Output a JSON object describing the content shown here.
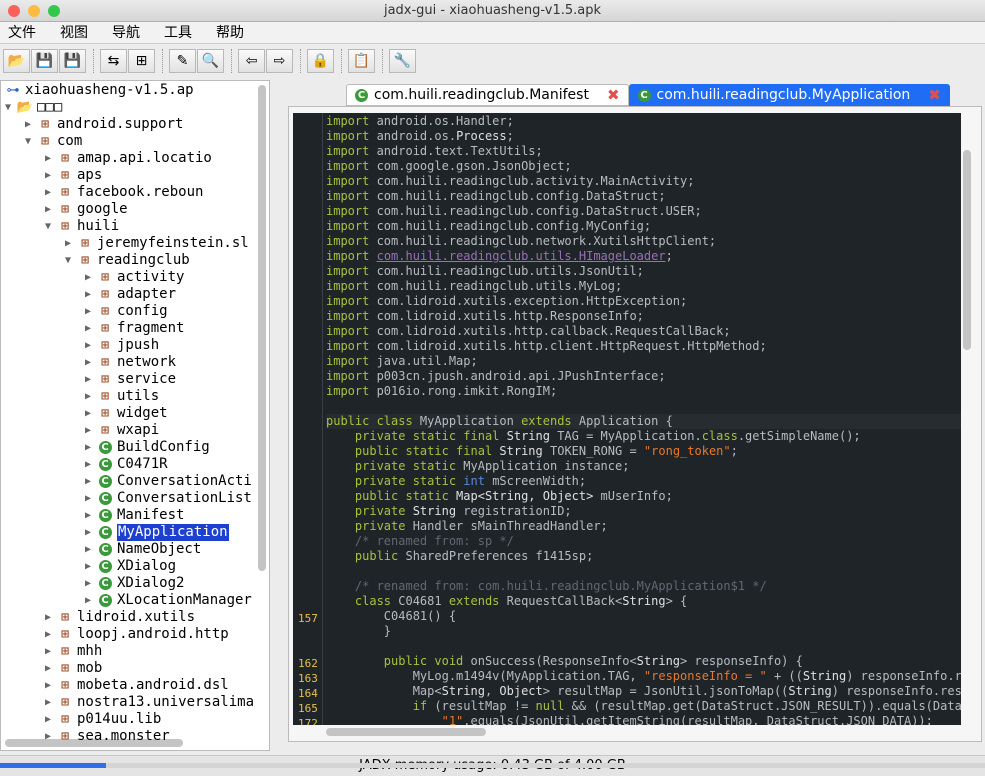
{
  "window": {
    "title": "jadx-gui - xiaohuasheng-v1.5.apk"
  },
  "menu": [
    "文件",
    "视图",
    "导航",
    "工具",
    "帮助"
  ],
  "toolbar": [
    {
      "icon": "open-file-icon",
      "glyph": "📂"
    },
    {
      "icon": "save-all-icon",
      "glyph": "💾"
    },
    {
      "icon": "export-icon",
      "glyph": "💾"
    },
    null,
    {
      "icon": "sync-icon",
      "glyph": "⇆"
    },
    {
      "icon": "flatten-packages-icon",
      "glyph": "⊞"
    },
    null,
    {
      "icon": "text-search-icon",
      "glyph": "✎"
    },
    {
      "icon": "class-search-icon",
      "glyph": "🔍"
    },
    null,
    {
      "icon": "back-icon",
      "glyph": "⇦"
    },
    {
      "icon": "forward-icon",
      "glyph": "⇨"
    },
    null,
    {
      "icon": "deobfuscation-icon",
      "glyph": "🔒"
    },
    null,
    {
      "icon": "log-icon",
      "glyph": "📋"
    },
    null,
    {
      "icon": "preferences-icon",
      "glyph": "🔧"
    }
  ],
  "tree": [
    {
      "label": "xiaohuasheng-v1.5.ap",
      "level": 0,
      "exp": "",
      "icon": "root"
    },
    {
      "label": "□□□",
      "level": 0,
      "exp": "open",
      "icon": "folder"
    },
    {
      "label": "android.support",
      "level": 1,
      "exp": "closed",
      "icon": "pkg"
    },
    {
      "label": "com",
      "level": 1,
      "exp": "open",
      "icon": "pkg"
    },
    {
      "label": "amap.api.locatio",
      "level": 2,
      "exp": "closed",
      "icon": "pkg"
    },
    {
      "label": "aps",
      "level": 2,
      "exp": "closed",
      "icon": "pkg"
    },
    {
      "label": "facebook.reboun",
      "level": 2,
      "exp": "closed",
      "icon": "pkg"
    },
    {
      "label": "google",
      "level": 2,
      "exp": "closed",
      "icon": "pkg"
    },
    {
      "label": "huili",
      "level": 2,
      "exp": "open",
      "icon": "pkg"
    },
    {
      "label": "jeremyfeinstein.sl",
      "level": 3,
      "exp": "closed",
      "icon": "pkg"
    },
    {
      "label": "readingclub",
      "level": 3,
      "exp": "open",
      "icon": "pkg"
    },
    {
      "label": "activity",
      "level": 4,
      "exp": "closed",
      "icon": "pkg"
    },
    {
      "label": "adapter",
      "level": 4,
      "exp": "closed",
      "icon": "pkg"
    },
    {
      "label": "config",
      "level": 4,
      "exp": "closed",
      "icon": "pkg"
    },
    {
      "label": "fragment",
      "level": 4,
      "exp": "closed",
      "icon": "pkg"
    },
    {
      "label": "jpush",
      "level": 4,
      "exp": "closed",
      "icon": "pkg"
    },
    {
      "label": "network",
      "level": 4,
      "exp": "closed",
      "icon": "pkg"
    },
    {
      "label": "service",
      "level": 4,
      "exp": "closed",
      "icon": "pkg"
    },
    {
      "label": "utils",
      "level": 4,
      "exp": "closed",
      "icon": "pkg"
    },
    {
      "label": "widget",
      "level": 4,
      "exp": "closed",
      "icon": "pkg"
    },
    {
      "label": "wxapi",
      "level": 4,
      "exp": "closed",
      "icon": "pkg"
    },
    {
      "label": "BuildConfig",
      "level": 4,
      "exp": "closed",
      "icon": "cls"
    },
    {
      "label": "C0471R",
      "level": 4,
      "exp": "closed",
      "icon": "cls"
    },
    {
      "label": "ConversationActi",
      "level": 4,
      "exp": "closed",
      "icon": "cls"
    },
    {
      "label": "ConversationList",
      "level": 4,
      "exp": "closed",
      "icon": "cls"
    },
    {
      "label": "Manifest",
      "level": 4,
      "exp": "closed",
      "icon": "cls"
    },
    {
      "label": "MyApplication",
      "level": 4,
      "exp": "closed",
      "icon": "cls",
      "selected": true
    },
    {
      "label": "NameObject",
      "level": 4,
      "exp": "closed",
      "icon": "cls"
    },
    {
      "label": "XDialog",
      "level": 4,
      "exp": "closed",
      "icon": "cls"
    },
    {
      "label": "XDialog2",
      "level": 4,
      "exp": "closed",
      "icon": "cls"
    },
    {
      "label": "XLocationManager",
      "level": 4,
      "exp": "closed",
      "icon": "cls"
    },
    {
      "label": "lidroid.xutils",
      "level": 2,
      "exp": "closed",
      "icon": "pkg"
    },
    {
      "label": "loopj.android.http",
      "level": 2,
      "exp": "closed",
      "icon": "pkg"
    },
    {
      "label": "mhh",
      "level": 2,
      "exp": "closed",
      "icon": "pkg"
    },
    {
      "label": "mob",
      "level": 2,
      "exp": "closed",
      "icon": "pkg"
    },
    {
      "label": "mobeta.android.dsl",
      "level": 2,
      "exp": "closed",
      "icon": "pkg"
    },
    {
      "label": "nostra13.universalima",
      "level": 2,
      "exp": "closed",
      "icon": "pkg"
    },
    {
      "label": "p014uu.lib",
      "level": 2,
      "exp": "closed",
      "icon": "pkg"
    },
    {
      "label": "sea.monster",
      "level": 2,
      "exp": "closed",
      "icon": "pkg"
    }
  ],
  "tabs": [
    {
      "label": "com.huili.readingclub.Manifest",
      "active": false
    },
    {
      "label": "com.huili.readingclub.MyApplication",
      "active": true
    }
  ],
  "code": [
    {
      "ln": "",
      "t": [
        [
          "k",
          "import"
        ],
        [
          "t",
          " android.os.Handler;"
        ]
      ]
    },
    {
      "ln": "",
      "t": [
        [
          "k",
          "import"
        ],
        [
          "t",
          " android.os."
        ],
        [
          "w",
          "Process"
        ],
        [
          "t",
          ";"
        ]
      ]
    },
    {
      "ln": "",
      "t": [
        [
          "k",
          "import"
        ],
        [
          "t",
          " android.text.TextUtils;"
        ]
      ]
    },
    {
      "ln": "",
      "t": [
        [
          "k",
          "import"
        ],
        [
          "t",
          " com.google.gson.JsonObject;"
        ]
      ]
    },
    {
      "ln": "",
      "t": [
        [
          "k",
          "import"
        ],
        [
          "t",
          " com.huili.readingclub.activity.MainActivity;"
        ]
      ]
    },
    {
      "ln": "",
      "t": [
        [
          "k",
          "import"
        ],
        [
          "t",
          " com.huili.readingclub.config.DataStruct;"
        ]
      ]
    },
    {
      "ln": "",
      "t": [
        [
          "k",
          "import"
        ],
        [
          "t",
          " com.huili.readingclub.config.DataStruct.USER;"
        ]
      ]
    },
    {
      "ln": "",
      "t": [
        [
          "k",
          "import"
        ],
        [
          "t",
          " com.huili.readingclub.config.MyConfig;"
        ]
      ]
    },
    {
      "ln": "",
      "t": [
        [
          "k",
          "import"
        ],
        [
          "t",
          " com.huili.readingclub.network.XutilsHttpClient;"
        ]
      ]
    },
    {
      "ln": "",
      "t": [
        [
          "k",
          "import"
        ],
        [
          "t",
          " "
        ],
        [
          "l",
          "com.huili.readingclub.utils.HImageLoader"
        ],
        [
          "t",
          ";"
        ]
      ]
    },
    {
      "ln": "",
      "t": [
        [
          "k",
          "import"
        ],
        [
          "t",
          " com.huili.readingclub.utils.JsonUtil;"
        ]
      ]
    },
    {
      "ln": "",
      "t": [
        [
          "k",
          "import"
        ],
        [
          "t",
          " com.huili.readingclub.utils.MyLog;"
        ]
      ]
    },
    {
      "ln": "",
      "t": [
        [
          "k",
          "import"
        ],
        [
          "t",
          " com.lidroid.xutils.exception.HttpException;"
        ]
      ]
    },
    {
      "ln": "",
      "t": [
        [
          "k",
          "import"
        ],
        [
          "t",
          " com.lidroid.xutils.http.ResponseInfo;"
        ]
      ]
    },
    {
      "ln": "",
      "t": [
        [
          "k",
          "import"
        ],
        [
          "t",
          " com.lidroid.xutils.http.callback.RequestCallBack;"
        ]
      ]
    },
    {
      "ln": "",
      "t": [
        [
          "k",
          "import"
        ],
        [
          "t",
          " com.lidroid.xutils.http.client.HttpRequest.HttpMethod;"
        ]
      ]
    },
    {
      "ln": "",
      "t": [
        [
          "k",
          "import"
        ],
        [
          "t",
          " java.util.Map;"
        ]
      ]
    },
    {
      "ln": "",
      "t": [
        [
          "k",
          "import"
        ],
        [
          "t",
          " p003cn.jpush.android.api.JPushInterface;"
        ]
      ]
    },
    {
      "ln": "",
      "t": [
        [
          "k",
          "import"
        ],
        [
          "t",
          " p016io.rong.imkit.RongIM;"
        ]
      ]
    },
    {
      "ln": "",
      "t": []
    },
    {
      "ln": "",
      "hl": true,
      "t": [
        [
          "k",
          "public class"
        ],
        [
          "t",
          " MyApplication "
        ],
        [
          "k",
          "extends"
        ],
        [
          "t",
          " Application {"
        ]
      ]
    },
    {
      "ln": "",
      "t": [
        [
          "t",
          "    "
        ],
        [
          "k",
          "private static final"
        ],
        [
          "w",
          " String"
        ],
        [
          "t",
          " TAG = MyApplication."
        ],
        [
          "k",
          "class"
        ],
        [
          "t",
          ".getSimpleName();"
        ]
      ]
    },
    {
      "ln": "",
      "t": [
        [
          "t",
          "    "
        ],
        [
          "k",
          "public static final"
        ],
        [
          "w",
          " String"
        ],
        [
          "t",
          " TOKEN_RONG = "
        ],
        [
          "s",
          "\"rong_token\""
        ],
        [
          "t",
          ";"
        ]
      ]
    },
    {
      "ln": "",
      "t": [
        [
          "t",
          "    "
        ],
        [
          "k",
          "private static"
        ],
        [
          "t",
          " MyApplication instance;"
        ]
      ]
    },
    {
      "ln": "",
      "t": [
        [
          "t",
          "    "
        ],
        [
          "k",
          "private static"
        ],
        [
          "ty",
          " int"
        ],
        [
          "t",
          " mScreenWidth;"
        ]
      ]
    },
    {
      "ln": "",
      "t": [
        [
          "t",
          "    "
        ],
        [
          "k",
          "public static"
        ],
        [
          "w",
          " Map<String, Object>"
        ],
        [
          "t",
          " mUserInfo;"
        ]
      ]
    },
    {
      "ln": "",
      "t": [
        [
          "t",
          "    "
        ],
        [
          "k",
          "private"
        ],
        [
          "w",
          " String"
        ],
        [
          "t",
          " registrationID;"
        ]
      ]
    },
    {
      "ln": "",
      "t": [
        [
          "t",
          "    "
        ],
        [
          "k",
          "private"
        ],
        [
          "t",
          " Handler sMainThreadHandler;"
        ]
      ]
    },
    {
      "ln": "",
      "t": [
        [
          "c",
          "    /* renamed from: sp */"
        ]
      ]
    },
    {
      "ln": "",
      "t": [
        [
          "t",
          "    "
        ],
        [
          "k",
          "public"
        ],
        [
          "t",
          " SharedPreferences f1415sp;"
        ]
      ]
    },
    {
      "ln": "",
      "t": []
    },
    {
      "ln": "",
      "t": [
        [
          "c",
          "    /* renamed from: com.huili.readingclub.MyApplication$1 */"
        ]
      ]
    },
    {
      "ln": "",
      "t": [
        [
          "t",
          "    "
        ],
        [
          "k",
          "class"
        ],
        [
          "t",
          " C04681 "
        ],
        [
          "k",
          "extends"
        ],
        [
          "t",
          " RequestCallBack<"
        ],
        [
          "w",
          "String"
        ],
        [
          "t",
          "> {"
        ]
      ]
    },
    {
      "ln": "157",
      "t": [
        [
          "t",
          "        C04681() {"
        ]
      ]
    },
    {
      "ln": "",
      "t": [
        [
          "t",
          "        }"
        ]
      ]
    },
    {
      "ln": "",
      "t": []
    },
    {
      "ln": "162",
      "t": [
        [
          "t",
          "        "
        ],
        [
          "k",
          "public void"
        ],
        [
          "t",
          " onSuccess(ResponseInfo<"
        ],
        [
          "w",
          "String"
        ],
        [
          "t",
          "> responseInfo) {"
        ]
      ]
    },
    {
      "ln": "163",
      "t": [
        [
          "t",
          "            MyLog.m1494v(MyApplication.TAG, "
        ],
        [
          "s",
          "\"responseInfo = \""
        ],
        [
          "t",
          " + (("
        ],
        [
          "w",
          "String"
        ],
        [
          "t",
          ") responseInfo.result));"
        ]
      ]
    },
    {
      "ln": "164",
      "t": [
        [
          "t",
          "            Map<"
        ],
        [
          "w",
          "String"
        ],
        [
          "t",
          ", "
        ],
        [
          "w",
          "Object"
        ],
        [
          "t",
          "> resultMap = JsonUtil.jsonToMap(("
        ],
        [
          "w",
          "String"
        ],
        [
          "t",
          ") responseInfo.result);"
        ]
      ]
    },
    {
      "ln": "165",
      "t": [
        [
          "t",
          "            "
        ],
        [
          "k",
          "if"
        ],
        [
          "t",
          " (resultMap != "
        ],
        [
          "k",
          "null"
        ],
        [
          "t",
          " && (resultMap.get(DataStruct.JSON_RESULT)).equals(DataStruct"
        ]
      ]
    },
    {
      "ln": "172",
      "t": [
        [
          "t",
          "                "
        ],
        [
          "s",
          "\"1\""
        ],
        [
          "t",
          ".equals(JsonUtil.getItemString(resultMap, DataStruct.JSON_DATA));"
        ]
      ]
    }
  ],
  "status": {
    "memory_text": "JADX memory usage: 0.43 GB of 4.00 GB",
    "memory_used_gb": 0.43,
    "memory_total_gb": 4.0
  },
  "colors": {
    "accent": "#1f6cf5",
    "selection": "#1d40d0",
    "code_bg": "#1f2428",
    "keyword": "#a6c23c",
    "string": "#e8782a"
  }
}
